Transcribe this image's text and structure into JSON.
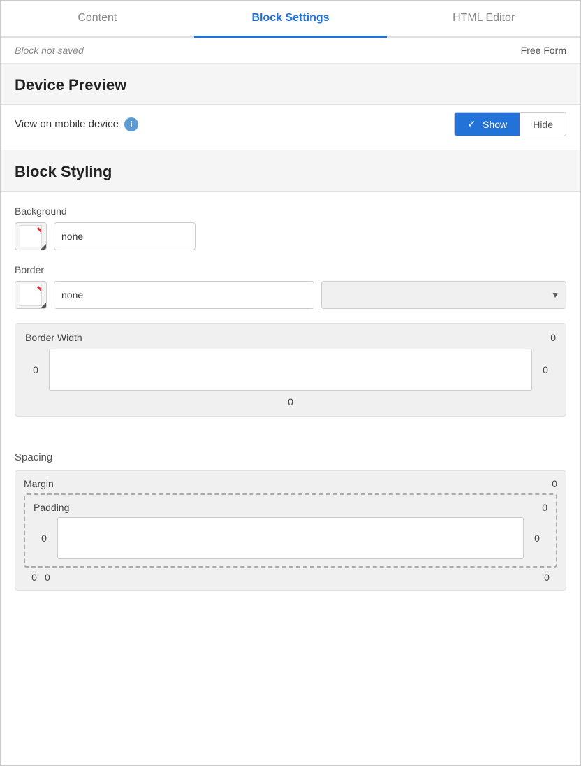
{
  "tabs": [
    {
      "id": "content",
      "label": "Content",
      "active": false
    },
    {
      "id": "block-settings",
      "label": "Block Settings",
      "active": true
    },
    {
      "id": "html-editor",
      "label": "HTML Editor",
      "active": false
    }
  ],
  "status": {
    "block_not_saved": "Block not saved",
    "free_form": "Free Form"
  },
  "device_preview": {
    "title": "Device Preview",
    "mobile_label": "View on mobile device",
    "show_label": "Show",
    "hide_label": "Hide"
  },
  "block_styling": {
    "title": "Block Styling",
    "background": {
      "label": "Background",
      "value": "none"
    },
    "border": {
      "label": "Border",
      "value": "none",
      "select_placeholder": ""
    },
    "border_width": {
      "label": "Border Width",
      "top": "0",
      "left": "0",
      "right": "0",
      "bottom": "0"
    }
  },
  "spacing": {
    "label": "Spacing",
    "margin": {
      "label": "Margin",
      "value": "0"
    },
    "padding": {
      "label": "Padding",
      "top": "0",
      "left": "0",
      "right": "0",
      "bottom": "0",
      "outer_left": "0",
      "outer_right": "0"
    }
  }
}
